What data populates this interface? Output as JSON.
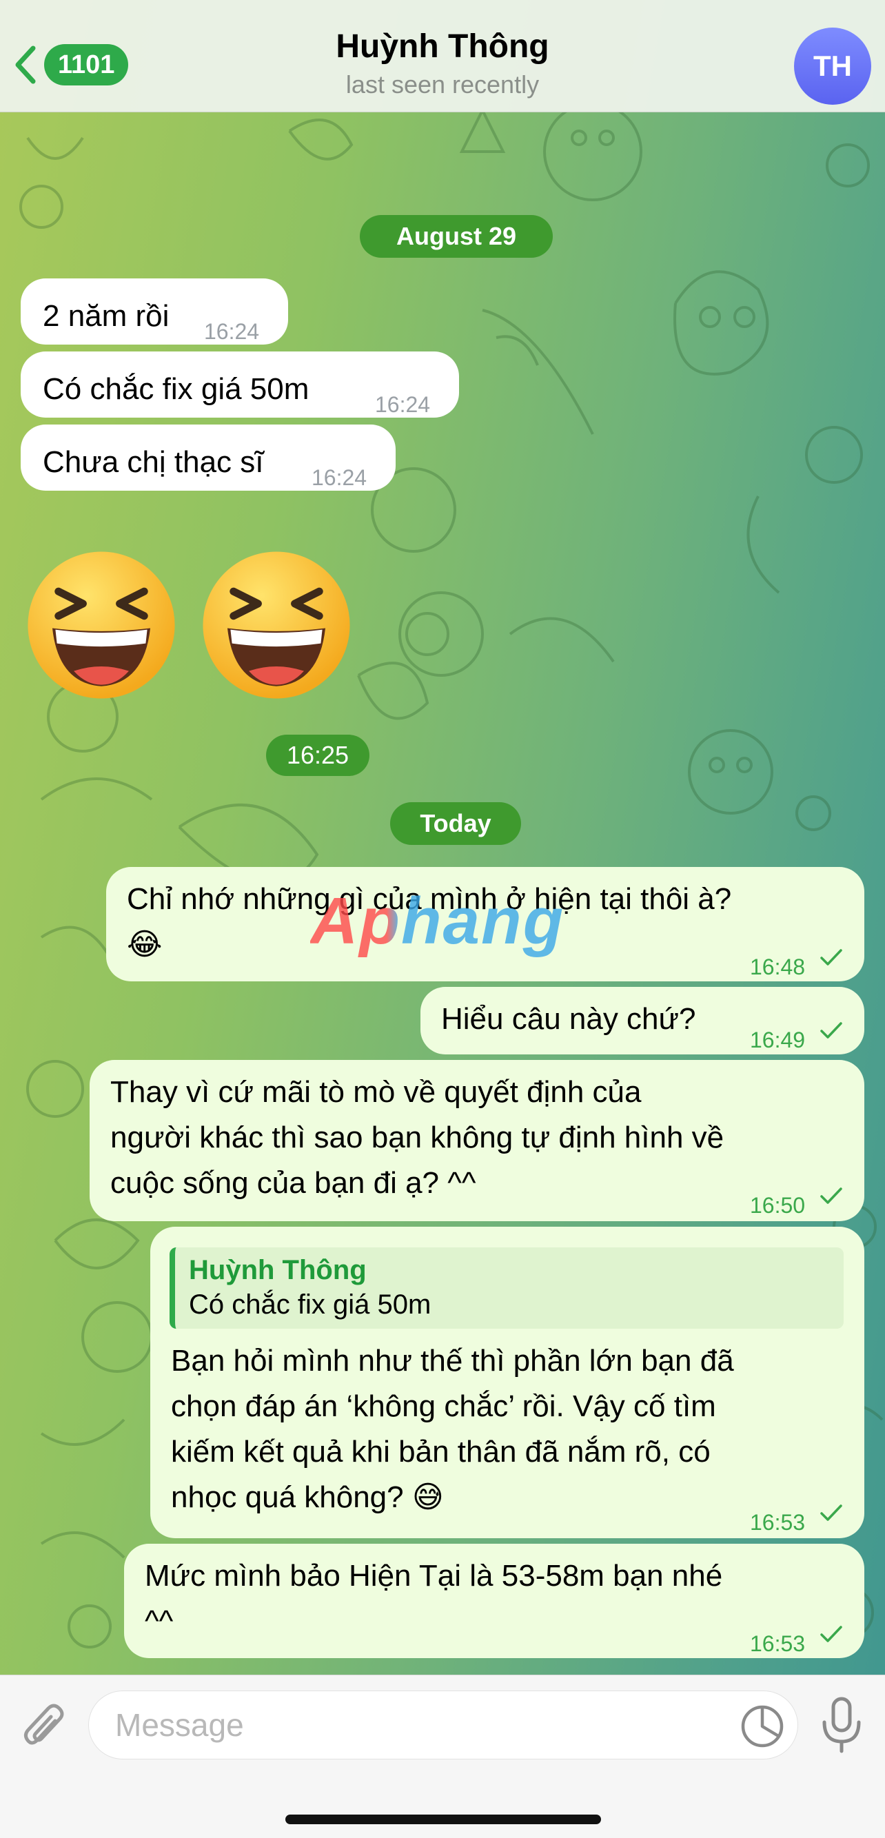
{
  "header": {
    "back_count": "1101",
    "title": "Huỳnh Thông",
    "subtitle": "last seen recently",
    "avatar_initials": "TH",
    "avatar_color": "#6a74ff"
  },
  "watermark": "Aphang",
  "dates": {
    "first": "August 29",
    "second": "Today"
  },
  "messages_in": [
    {
      "text": "2 năm rồi",
      "time": "16:24"
    },
    {
      "text": "Có chắc fix giá 50m",
      "time": "16:24"
    },
    {
      "text": "Chưa chị thạc sĩ",
      "time": "16:24"
    }
  ],
  "emoji_message": {
    "emoji": "😆😆",
    "time": "16:25"
  },
  "messages_out": [
    {
      "line1": "Chỉ nhớ những gì của mình ở hiện tại thôi à?",
      "line2": "😂",
      "time": "16:48"
    },
    {
      "text": "Hiểu câu này chứ?",
      "time": "16:49"
    },
    {
      "line1": "Thay vì cứ mãi tò mò về quyết định của",
      "line2": "người khác thì sao bạn không tự định hình về",
      "line3": "cuộc sống của bạn đi ạ? ^^",
      "time": "16:50"
    },
    {
      "reply_name": "Huỳnh Thông",
      "reply_text": "Có chắc fix giá 50m",
      "line1": "Bạn hỏi mình như thế thì phần lớn bạn đã",
      "line2": "chọn đáp án ‘không chắc’ rồi. Vậy cố tìm",
      "line3": "kiếm kết quả khi bản thân đã nắm rõ, có",
      "line4": "nhọc quá không? 😅",
      "time": "16:53"
    },
    {
      "line1": "Mức mình bảo Hiện Tại là 53-58m bạn nhé",
      "line2": "^^",
      "time": "16:53"
    }
  ],
  "composer": {
    "placeholder": "Message"
  },
  "colors": {
    "accent": "#2eaa4a",
    "outgoing_bubble": "#effdde",
    "incoming_bubble": "#ffffff",
    "date_pill": "#3f9a2e"
  }
}
